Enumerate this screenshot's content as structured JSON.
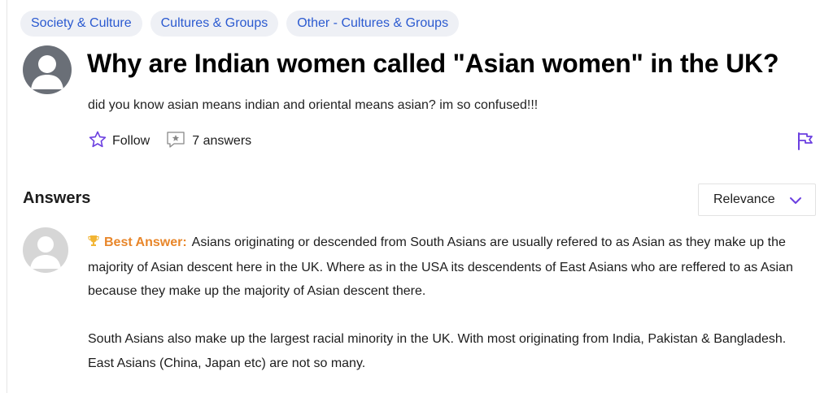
{
  "tags": [
    "Society & Culture",
    "Cultures & Groups",
    "Other - Cultures & Groups"
  ],
  "question": {
    "title": "Why are Indian women called \"Asian women\" in the UK?",
    "body": "did you know asian means indian and oriental means asian? im so confused!!!",
    "follow_label": "Follow",
    "answers_count_label": "7 answers"
  },
  "answers_section": {
    "heading": "Answers",
    "sort_label": "Relevance"
  },
  "best_answer": {
    "label": "Best Answer:",
    "para1": "Asians originating or descended from South Asians are usually refered to as Asian as they make up the majority of Asian descent here in the UK. Where as in the USA its descendents of East Asians who are reffered to as Asian because they make up the majority of Asian descent there.",
    "para2": "South Asians also make up the largest racial minority in the UK. With most originating from India, Pakistan & Bangladesh. East Asians (China, Japan etc) are not so many."
  },
  "colors": {
    "tag_text": "#2b5ad0",
    "tag_bg": "#eef0f5",
    "accent_purple": "#6b3fe0",
    "best_answer": "#e8862a"
  },
  "icons": [
    "user-avatar-icon",
    "star-icon",
    "answers-icon",
    "flag-icon",
    "chevron-down-icon",
    "trophy-icon"
  ]
}
